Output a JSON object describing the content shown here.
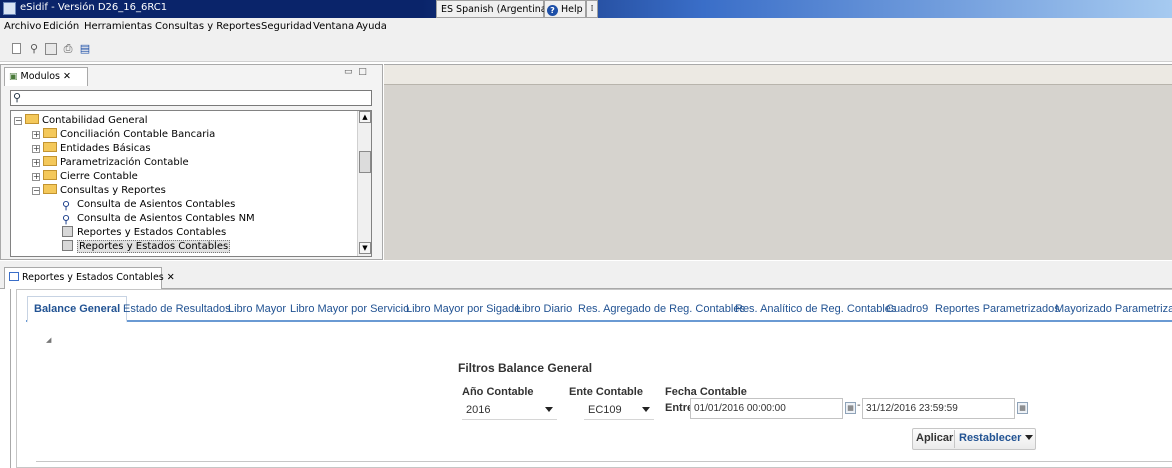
{
  "window": {
    "title": "eSidif - Versión D26_16_6RC1",
    "language": "ES Spanish (Argentina)",
    "help_label": "Help",
    "grip": "⁞"
  },
  "menubar": {
    "items": [
      "Archivo",
      "Edición",
      "Herramientas",
      "Consultas y Reportes",
      "Seguridad",
      "Ventana",
      "Ayuda"
    ]
  },
  "toolbar": {
    "icons": [
      "new-file-icon",
      "search-icon",
      "save-icon",
      "print-icon",
      "export-icon"
    ]
  },
  "modules": {
    "tab_label": "Modulos",
    "close": "✕",
    "search_placeholder": "",
    "tree": [
      {
        "label": "Contabilidad General",
        "expander": "−",
        "type": "folder"
      },
      {
        "label": "Conciliación Contable Bancaria",
        "expander": "+",
        "type": "folder"
      },
      {
        "label": "Entidades Básicas",
        "expander": "+",
        "type": "folder"
      },
      {
        "label": "Parametrización Contable",
        "expander": "+",
        "type": "folder"
      },
      {
        "label": "Cierre Contable",
        "expander": "+",
        "type": "folder"
      },
      {
        "label": "Consultas y Reportes",
        "expander": "−",
        "type": "folder"
      },
      {
        "label": "Consulta de Asientos Contables",
        "type": "query"
      },
      {
        "label": "Consulta de Asientos Contables NM",
        "type": "query"
      },
      {
        "label": "Reportes y Estados Contables",
        "type": "report"
      },
      {
        "label": "Reportes y Estados Contables",
        "type": "report",
        "selected": true
      }
    ]
  },
  "view": {
    "tab_label": "Reportes y Estados Contables",
    "close": "✕",
    "tabs": [
      {
        "label": "Balance General",
        "active": true
      },
      {
        "label": "Estado de Resultados"
      },
      {
        "label": "Libro Mayor"
      },
      {
        "label": "Libro Mayor por Servicio"
      },
      {
        "label": "Libro Mayor por Sigade"
      },
      {
        "label": "Libro Diario"
      },
      {
        "label": "Res. Agregado de Reg. Contables"
      },
      {
        "label": "Res. Analítico de Reg. Contables"
      },
      {
        "label": "Cuadro9"
      },
      {
        "label": "Reportes Parametrizados"
      },
      {
        "label": "Mayorizado Parametrizable"
      }
    ]
  },
  "filters": {
    "title": "Filtros Balance General",
    "anio_label": "Año Contable",
    "anio_value": "2016",
    "ente_label": "Ente Contable",
    "ente_value": "EC109",
    "fecha_label": "Fecha Contable",
    "entre_label": "Entre",
    "fecha_desde": "01/01/2016 00:00:00",
    "fecha_hasta": "31/12/2016 23:59:59",
    "dash": "-"
  },
  "buttons": {
    "aplicar": "Aplicar",
    "restablecer": "Restablecer"
  }
}
